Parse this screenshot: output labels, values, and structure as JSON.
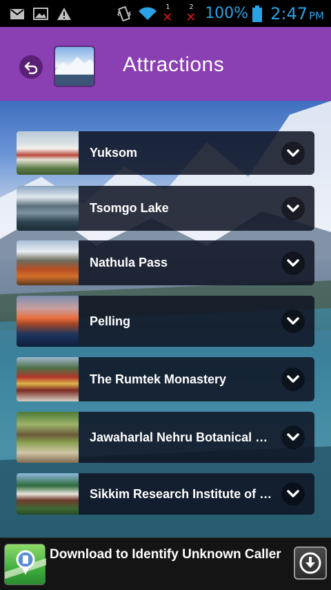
{
  "status_bar": {
    "sim1_number": "1",
    "sim2_number": "2",
    "battery_percent": "100%",
    "time": "2:47",
    "ampm": "PM",
    "icons": [
      "gmail-icon",
      "image-icon",
      "warning-icon",
      "vibrate-icon",
      "wifi-icon",
      "battery-icon"
    ],
    "accent_color": "#29a3e6"
  },
  "header": {
    "title": "Attractions",
    "background_color": "#8a3fb3"
  },
  "attractions": [
    {
      "label": "Yuksom"
    },
    {
      "label": "Tsomgo Lake"
    },
    {
      "label": "Nathula Pass"
    },
    {
      "label": "Pelling"
    },
    {
      "label": "The Rumtek Monastery"
    },
    {
      "label": "Jawaharlal Nehru Botanical Garden"
    },
    {
      "label": "Sikkim Research Institute of Tibetology"
    }
  ],
  "ad": {
    "text": "Download to Identify Unknown Caller"
  }
}
